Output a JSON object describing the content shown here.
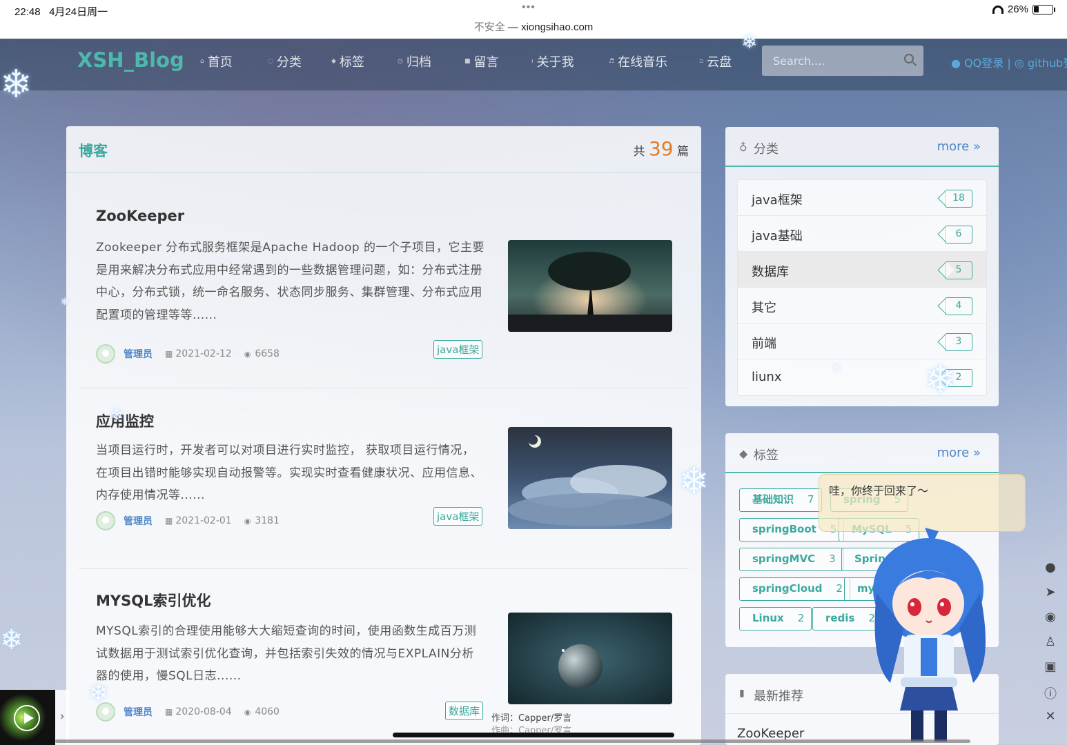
{
  "status_bar": {
    "time": "22:48",
    "date": "4月24日周一",
    "dots": "•••",
    "insecure": "不安全",
    "separator": " — ",
    "url": "xiongsihao.com",
    "battery": "26%"
  },
  "nav": {
    "brand": "XSH_Blog",
    "items": [
      {
        "label": "首页",
        "icon": "home-icon"
      },
      {
        "label": "分类",
        "icon": "idea-icon"
      },
      {
        "label": "标签",
        "icon": "tag-icon"
      },
      {
        "label": "归档",
        "icon": "clock-icon"
      },
      {
        "label": "留言",
        "icon": "comment-icon"
      },
      {
        "label": "关于我",
        "icon": "info-icon"
      },
      {
        "label": "在线音乐",
        "icon": "music-icon"
      },
      {
        "label": "云盘",
        "icon": "cloud-icon"
      }
    ],
    "search_placeholder": "Search....",
    "login": "QQ登录 | ",
    "github": "github登"
  },
  "blog": {
    "title": "博客",
    "count_prefix": "共",
    "count": "39",
    "count_suffix": "篇",
    "posts": [
      {
        "title": "ZooKeeper",
        "summary": "Zookeeper 分布式服务框架是Apache Hadoop 的一个子项目，它主要是用来解决分布式应用中经常遇到的一些数据管理问题，如：分布式注册中心，分布式锁，统一命名服务、状态同步服务、集群管理、分布式应用配置项的管理等等......",
        "author": "管理员",
        "date": "2021-02-12",
        "views": "6658",
        "tag": "java框架"
      },
      {
        "title": "应用监控",
        "summary": "当项目运行时，开发者可以对项目进行实时监控， 获取项目运行情况，在项目出错时能够实现自动报警等。实现实时查看健康状况、应用信息、内存使用情况等......",
        "author": "管理员",
        "date": "2021-02-01",
        "views": "3181",
        "tag": "java框架"
      },
      {
        "title": "MYSQL索引优化",
        "summary": "MYSQL索引的合理使用能够大大缩短查询的时间，使用函数生成百万测试数据用于测试索引优化查询，并包括索引失效的情况与EXPLAIN分析器的使用，慢SQL日志......",
        "author": "管理员",
        "date": "2020-08-04",
        "views": "4060",
        "tag": "数据库"
      }
    ]
  },
  "categories": {
    "title": "分类",
    "more": "more »",
    "items": [
      {
        "name": "java框架",
        "count": "18"
      },
      {
        "name": "java基础",
        "count": "6"
      },
      {
        "name": "数据库",
        "count": "5"
      },
      {
        "name": "其它",
        "count": "4"
      },
      {
        "name": "前端",
        "count": "3"
      },
      {
        "name": "liunx",
        "count": "2"
      }
    ]
  },
  "tags": {
    "title": "标签",
    "more": "more »",
    "items": [
      {
        "name": "基础知识",
        "count": "7"
      },
      {
        "name": "spring",
        "count": "5"
      },
      {
        "name": "springBoot",
        "count": "5"
      },
      {
        "name": "MySQL",
        "count": "5"
      },
      {
        "name": "springMVC",
        "count": "3"
      },
      {
        "name": "Spring",
        "count": ""
      },
      {
        "name": "springCloud",
        "count": "2"
      },
      {
        "name": "my",
        "count": ""
      },
      {
        "name": "Linux",
        "count": "2"
      },
      {
        "name": "redis",
        "count": "2"
      }
    ]
  },
  "recommend": {
    "title": "最新推荐",
    "first": "ZooKeeper"
  },
  "mascot": {
    "bubble": "哇，你终于回来了～"
  },
  "lyrics": {
    "line1": "作词：Capper/罗言",
    "line2": "作曲：Capper/罗言"
  },
  "colors": {
    "accent": "#3aa99e",
    "link": "#4e86c6",
    "count": "#e37d2a"
  }
}
